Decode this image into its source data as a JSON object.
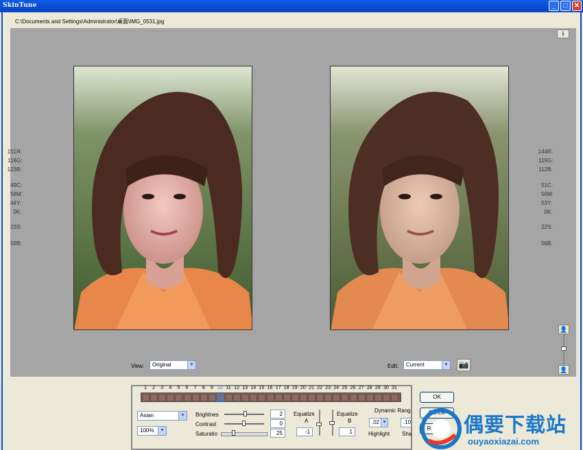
{
  "window": {
    "title": "SkinTune",
    "controls": {
      "minimize": "_",
      "maximize": "□",
      "close": "✕"
    }
  },
  "file_path": "C:\\Documents and Settings\\Administrator\\桌面\\IMG_0531.jpg",
  "info_button": "i",
  "readout_left": [
    {
      "label": "R:",
      "value": "151"
    },
    {
      "label": "G:",
      "value": "116"
    },
    {
      "label": "B:",
      "value": "123"
    },
    {
      "label": "C:",
      "value": "49"
    },
    {
      "label": "M:",
      "value": "58"
    },
    {
      "label": "Y:",
      "value": "44"
    },
    {
      "label": "K:",
      "value": "0"
    },
    {
      "label": "S:",
      "value": "23"
    },
    {
      "label": "B:",
      "value": "59"
    }
  ],
  "readout_right": [
    {
      "label": "R:",
      "value": "144"
    },
    {
      "label": "G:",
      "value": "119"
    },
    {
      "label": "B:",
      "value": "112"
    },
    {
      "label": "C:",
      "value": "51"
    },
    {
      "label": "M:",
      "value": "56"
    },
    {
      "label": "Y:",
      "value": "53"
    },
    {
      "label": "K:",
      "value": "0"
    },
    {
      "label": "S:",
      "value": "22"
    },
    {
      "label": "B:",
      "value": "56"
    }
  ],
  "view": {
    "label": "View:",
    "selected": "Original"
  },
  "edit": {
    "label": "Edit:",
    "selected": "Current"
  },
  "camera_icon": "📷",
  "zoom_icons": {
    "top": "👤",
    "bottom": "👤"
  },
  "swatch_numbers": [
    "1",
    "2",
    "3",
    "4",
    "5",
    "6",
    "7",
    "8",
    "9",
    "10",
    "11",
    "12",
    "13",
    "14",
    "15",
    "16",
    "17",
    "18",
    "19",
    "20",
    "21",
    "22",
    "23",
    "24",
    "25",
    "26",
    "27",
    "28",
    "29",
    "30",
    "31"
  ],
  "swatch_selected": 10,
  "skin_type": {
    "selected": "Asian"
  },
  "zoom": {
    "selected": "100%"
  },
  "adjustments": {
    "brightness": {
      "label": "Brightnes",
      "value": "2"
    },
    "contrast": {
      "label": "Contrast",
      "value": "0"
    },
    "saturation": {
      "label": "Saturatio",
      "value": "25"
    }
  },
  "equalize_a": {
    "label_1": "Equalize",
    "label_2": "A",
    "value": "-1"
  },
  "equalize_b": {
    "label_1": "Equalize",
    "label_2": "B",
    "value": "1"
  },
  "dynamic_range": {
    "label": "Dynamic Rang",
    "highlight": {
      "value": ".02",
      "label": "Highlight"
    },
    "shadow": {
      "value": ".10",
      "label": "Sha"
    }
  },
  "buttons": {
    "ok": "OK",
    "cancel": "Cancel",
    "reset": "Rese"
  },
  "watermark": {
    "text": "偶要下载站",
    "url": "ouyaoxiazai.com"
  },
  "colors": {
    "title_bar": "#0846c8",
    "workspace": "#a5a5a5",
    "swatch": "#8b6a62",
    "selected_swatch": "#3a7bd5",
    "watermark": "#1b78c9"
  }
}
